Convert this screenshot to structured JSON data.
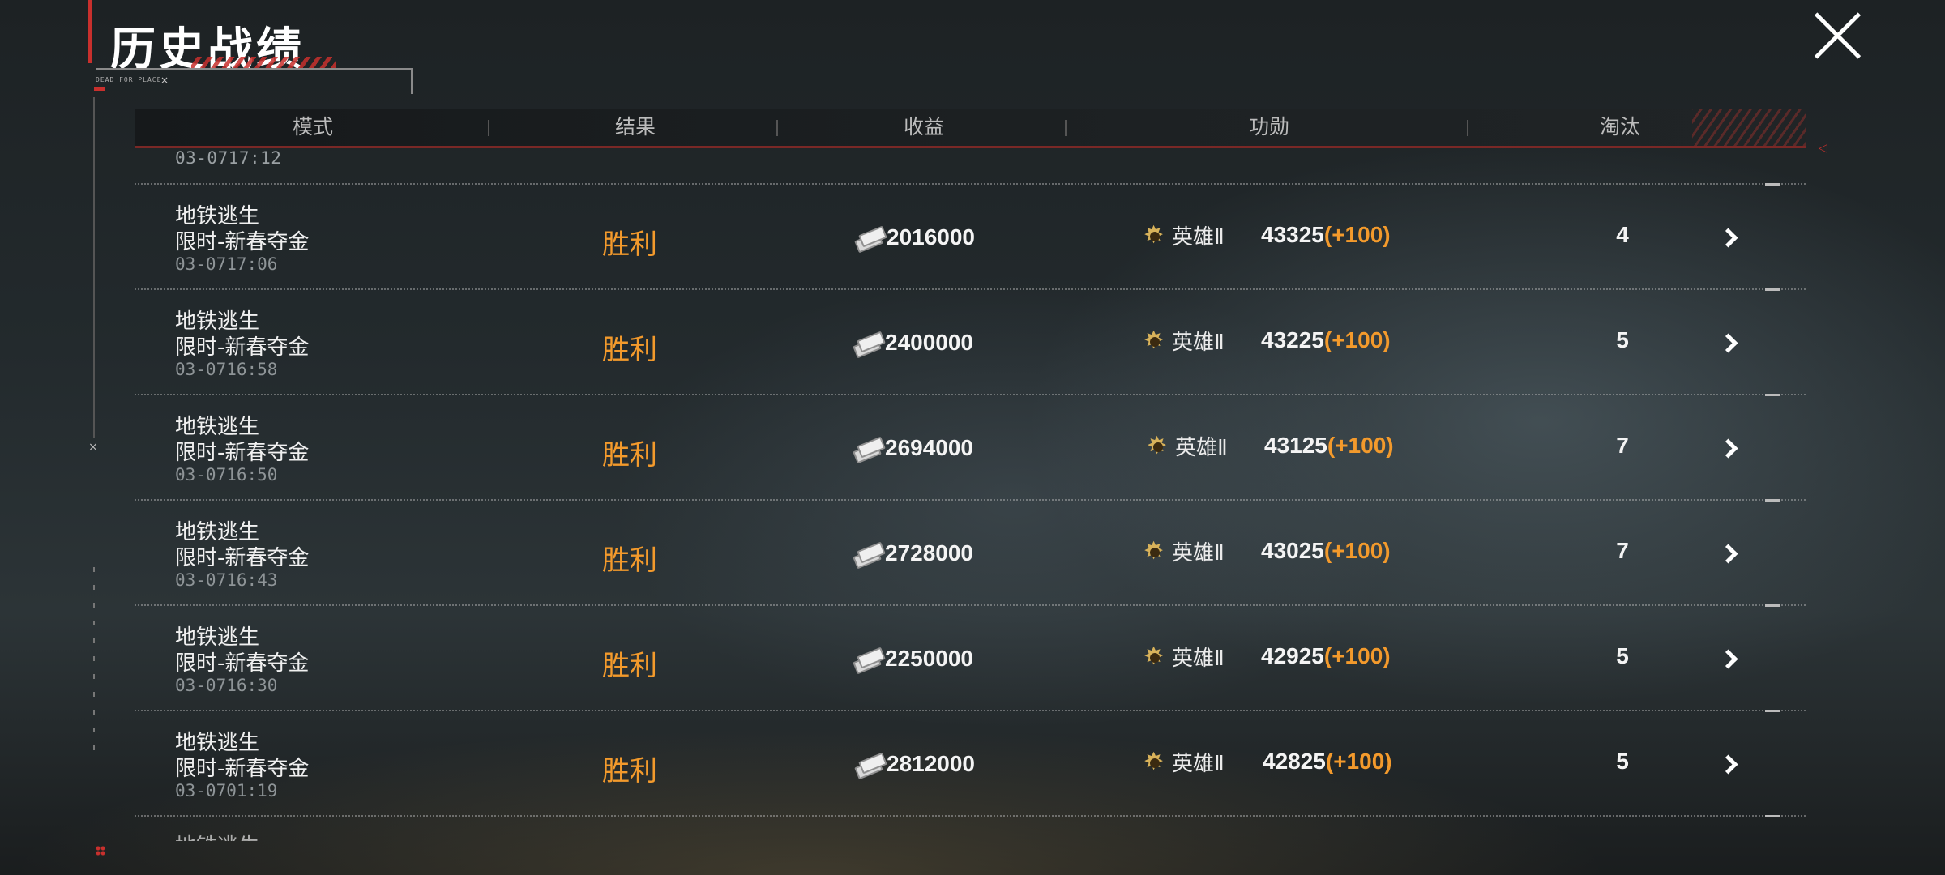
{
  "header": {
    "title": "历史战绩",
    "tag": "DEAD FOR PLACE"
  },
  "table": {
    "columns": [
      "模式",
      "结果",
      "收益",
      "功勋",
      "淘汰"
    ],
    "partial_top_date": "03-0717:12",
    "rows": [
      {
        "mode": "地铁逃生",
        "submode": "限时-新春夺金",
        "date": "03-0717:06",
        "result": "胜利",
        "earnings": "2016000",
        "rank": "英雄Ⅱ",
        "merit": "43325",
        "merit_delta": "(+100)",
        "eliminations": "4"
      },
      {
        "mode": "地铁逃生",
        "submode": "限时-新春夺金",
        "date": "03-0716:58",
        "result": "胜利",
        "earnings": "2400000",
        "rank": "英雄Ⅱ",
        "merit": "43225",
        "merit_delta": "(+100)",
        "eliminations": "5"
      },
      {
        "mode": "地铁逃生",
        "submode": "限时-新春夺金",
        "date": "03-0716:50",
        "result": "胜利",
        "earnings": "2694000",
        "rank": "英雄Ⅱ",
        "merit": "43125",
        "merit_delta": "(+100)",
        "eliminations": "7"
      },
      {
        "mode": "地铁逃生",
        "submode": "限时-新春夺金",
        "date": "03-0716:43",
        "result": "胜利",
        "earnings": "2728000",
        "rank": "英雄Ⅱ",
        "merit": "43025",
        "merit_delta": "(+100)",
        "eliminations": "7"
      },
      {
        "mode": "地铁逃生",
        "submode": "限时-新春夺金",
        "date": "03-0716:30",
        "result": "胜利",
        "earnings": "2250000",
        "rank": "英雄Ⅱ",
        "merit": "42925",
        "merit_delta": "(+100)",
        "eliminations": "5"
      },
      {
        "mode": "地铁逃生",
        "submode": "限时-新春夺金",
        "date": "03-0701:19",
        "result": "胜利",
        "earnings": "2812000",
        "rank": "英雄Ⅱ",
        "merit": "42825",
        "merit_delta": "(+100)",
        "eliminations": "5"
      }
    ],
    "partial_bottom_mode": "地铁逃生"
  },
  "colors": {
    "accent_red": "#c8302d",
    "victory_orange": "#f39a2c",
    "rank_gold": "#d8b25a"
  },
  "icons": {
    "close": "close-icon",
    "cash": "cash-icon",
    "rank": "rank-badge-icon",
    "chevron": "chevron-right-icon"
  }
}
